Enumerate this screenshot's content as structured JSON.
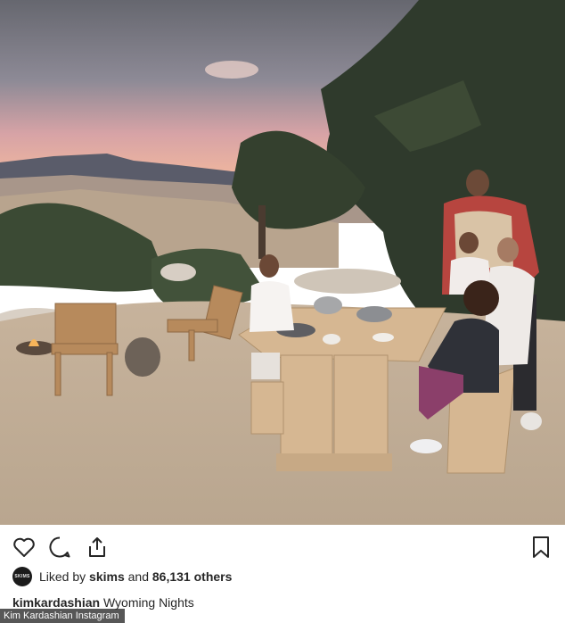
{
  "post": {
    "photo_alt_icon": "post-photo",
    "liked_by_prefix": "Liked by",
    "liked_by_user": "skims",
    "liked_by_avatar_text": "SKIMS",
    "liked_by_and": "and",
    "liked_by_count": "86,131 others",
    "caption_user": "kimkardashian",
    "caption_text": "Wyoming Nights"
  },
  "actions": {
    "like_icon": "heart-icon",
    "comment_icon": "comment-icon",
    "share_icon": "share-icon",
    "save_icon": "bookmark-icon"
  },
  "credit": {
    "text": "Kim Kardashian Instagram"
  },
  "colors": {
    "text": "#262626",
    "sky_top": "#6e6f78",
    "sky_glow": "#e9a9a0",
    "ground": "#c9b8a2"
  }
}
